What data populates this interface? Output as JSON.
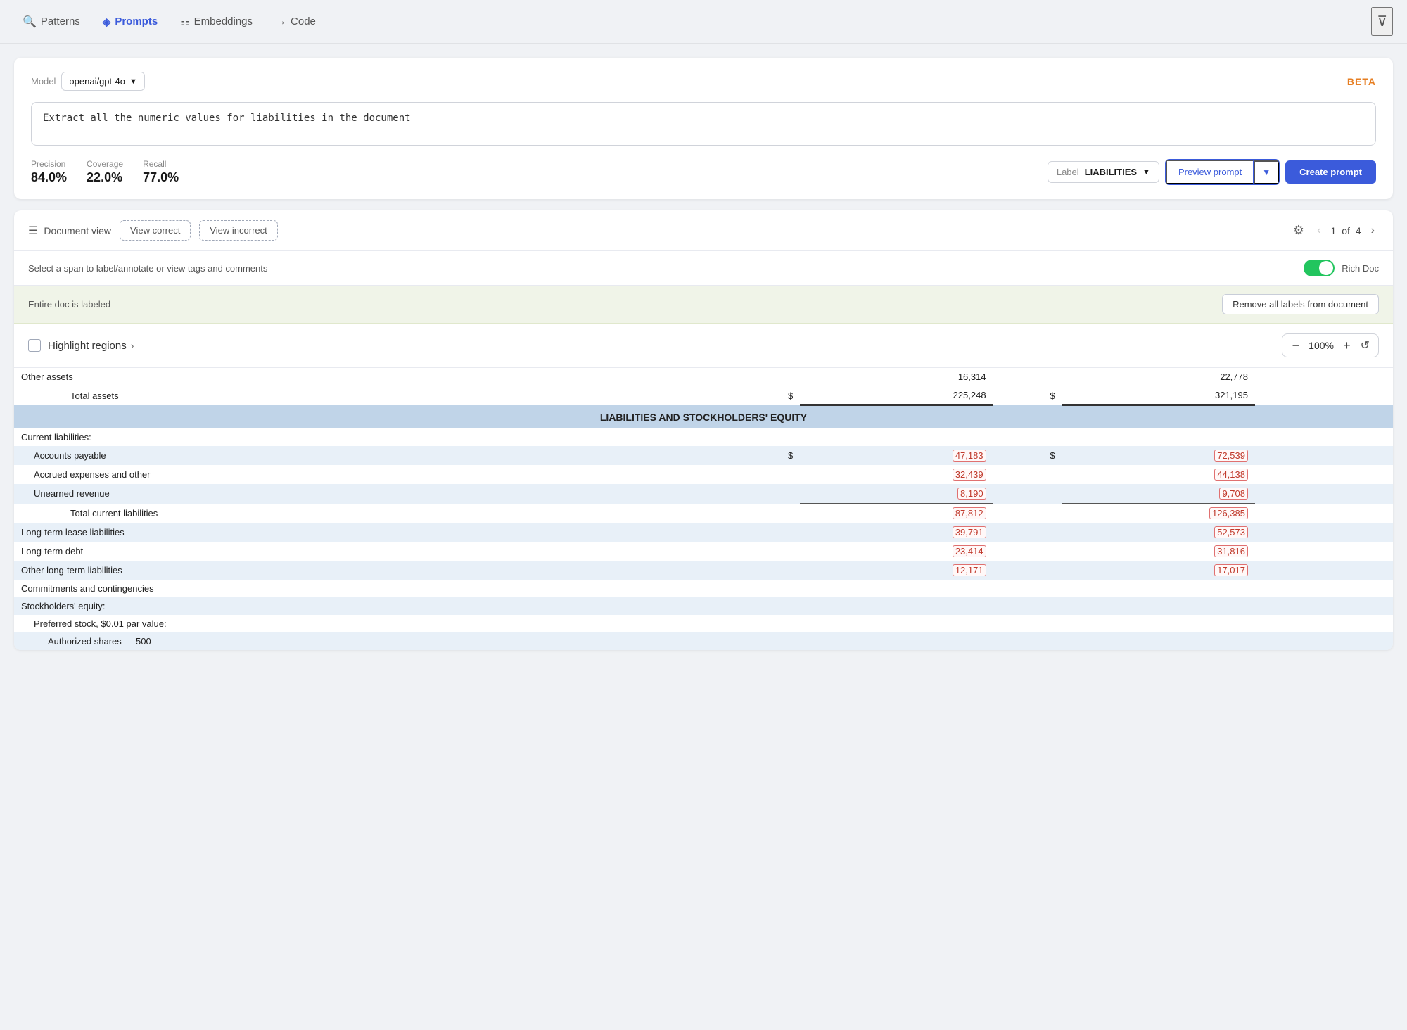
{
  "nav": {
    "items": [
      {
        "id": "patterns",
        "label": "Patterns",
        "icon": "🔍",
        "active": false
      },
      {
        "id": "prompts",
        "label": "Prompts",
        "icon": "🔷",
        "active": true
      },
      {
        "id": "embeddings",
        "label": "Embeddings",
        "icon": "⚏",
        "active": false
      },
      {
        "id": "code",
        "label": "Code",
        "icon": "→",
        "active": false
      }
    ],
    "filter_icon": "▽",
    "beta_label": "BETA"
  },
  "model": {
    "label": "Model",
    "value": "openai/gpt-4o"
  },
  "prompt": {
    "text": "Extract all the numeric values for liabilities in the document"
  },
  "metrics": {
    "precision": {
      "label": "Precision",
      "value": "84.0%"
    },
    "coverage": {
      "label": "Coverage",
      "value": "22.0%"
    },
    "recall": {
      "label": "Recall",
      "value": "77.0%"
    }
  },
  "label_select": {
    "label": "Label",
    "value": "LIABILITIES"
  },
  "buttons": {
    "preview_prompt": "Preview prompt",
    "create_prompt": "Create prompt"
  },
  "doc_view": {
    "label": "Document view",
    "view_correct": "View correct",
    "view_incorrect": "View incorrect",
    "page_current": "1",
    "page_of": "of",
    "page_total": "4"
  },
  "annotation": {
    "text": "Select a span to label/annotate or view tags and comments",
    "toggle_label": "Rich Doc",
    "toggle_on": true
  },
  "labeled_banner": {
    "text": "Entire doc is labeled",
    "remove_btn": "Remove all labels from document"
  },
  "highlight": {
    "label": "Highlight regions",
    "zoom_minus": "−",
    "zoom_value": "100%",
    "zoom_plus": "+"
  },
  "table": {
    "rows": [
      {
        "type": "partial-header",
        "col1": "Other assets",
        "col2": "",
        "col3": "16,314",
        "col4": "",
        "col5": "22,778",
        "labeled3": false,
        "labeled5": false,
        "style": "white"
      },
      {
        "type": "total",
        "col1": "Total assets",
        "col2": "$",
        "col3": "225,248",
        "col4": "$",
        "col5": "321,195",
        "labeled3": false,
        "labeled5": false,
        "style": "white",
        "indent": "2"
      },
      {
        "type": "section-header",
        "col1": "LIABILITIES AND STOCKHOLDERS' EQUITY",
        "style": "header"
      },
      {
        "type": "subheader",
        "col1": "Current liabilities:",
        "style": "white"
      },
      {
        "type": "data",
        "col1": "Accounts payable",
        "col2": "$",
        "col3": "47,183",
        "col4": "$",
        "col5": "72,539",
        "labeled3": true,
        "labeled5": true,
        "style": "light"
      },
      {
        "type": "data",
        "col1": "Accrued expenses and other",
        "col2": "",
        "col3": "32,439",
        "col4": "",
        "col5": "44,138",
        "labeled3": true,
        "labeled5": true,
        "style": "white"
      },
      {
        "type": "data",
        "col1": "Unearned revenue",
        "col2": "",
        "col3": "8,190",
        "col4": "",
        "col5": "9,708",
        "labeled3": true,
        "labeled5": true,
        "style": "light"
      },
      {
        "type": "total",
        "col1": "Total current liabilities",
        "col2": "",
        "col3": "87,812",
        "col4": "",
        "col5": "126,385",
        "labeled3": true,
        "labeled5": true,
        "style": "white",
        "indent": "2"
      },
      {
        "type": "data",
        "col1": "Long-term lease liabilities",
        "col2": "",
        "col3": "39,791",
        "col4": "",
        "col5": "52,573",
        "labeled3": true,
        "labeled5": true,
        "style": "light"
      },
      {
        "type": "data",
        "col1": "Long-term debt",
        "col2": "",
        "col3": "23,414",
        "col4": "",
        "col5": "31,816",
        "labeled3": true,
        "labeled5": true,
        "style": "white"
      },
      {
        "type": "data",
        "col1": "Other long-term liabilities",
        "col2": "",
        "col3": "12,171",
        "col4": "",
        "col5": "17,017",
        "labeled3": true,
        "labeled5": true,
        "style": "light"
      },
      {
        "type": "data",
        "col1": "Commitments and contingencies",
        "col2": "",
        "col3": "",
        "col4": "",
        "col5": "",
        "labeled3": false,
        "labeled5": false,
        "style": "white"
      },
      {
        "type": "subheader",
        "col1": "Stockholders' equity:",
        "style": "light"
      },
      {
        "type": "data",
        "col1": "Preferred stock, $0.01 par value:",
        "col2": "",
        "col3": "",
        "col4": "",
        "col5": "",
        "labeled3": false,
        "labeled5": false,
        "style": "white",
        "indent": "1"
      },
      {
        "type": "data",
        "col1": "Authorized shares — 500",
        "col2": "",
        "col3": "",
        "col4": "",
        "col5": "",
        "labeled3": false,
        "labeled5": false,
        "style": "light",
        "indent": "2"
      }
    ]
  }
}
